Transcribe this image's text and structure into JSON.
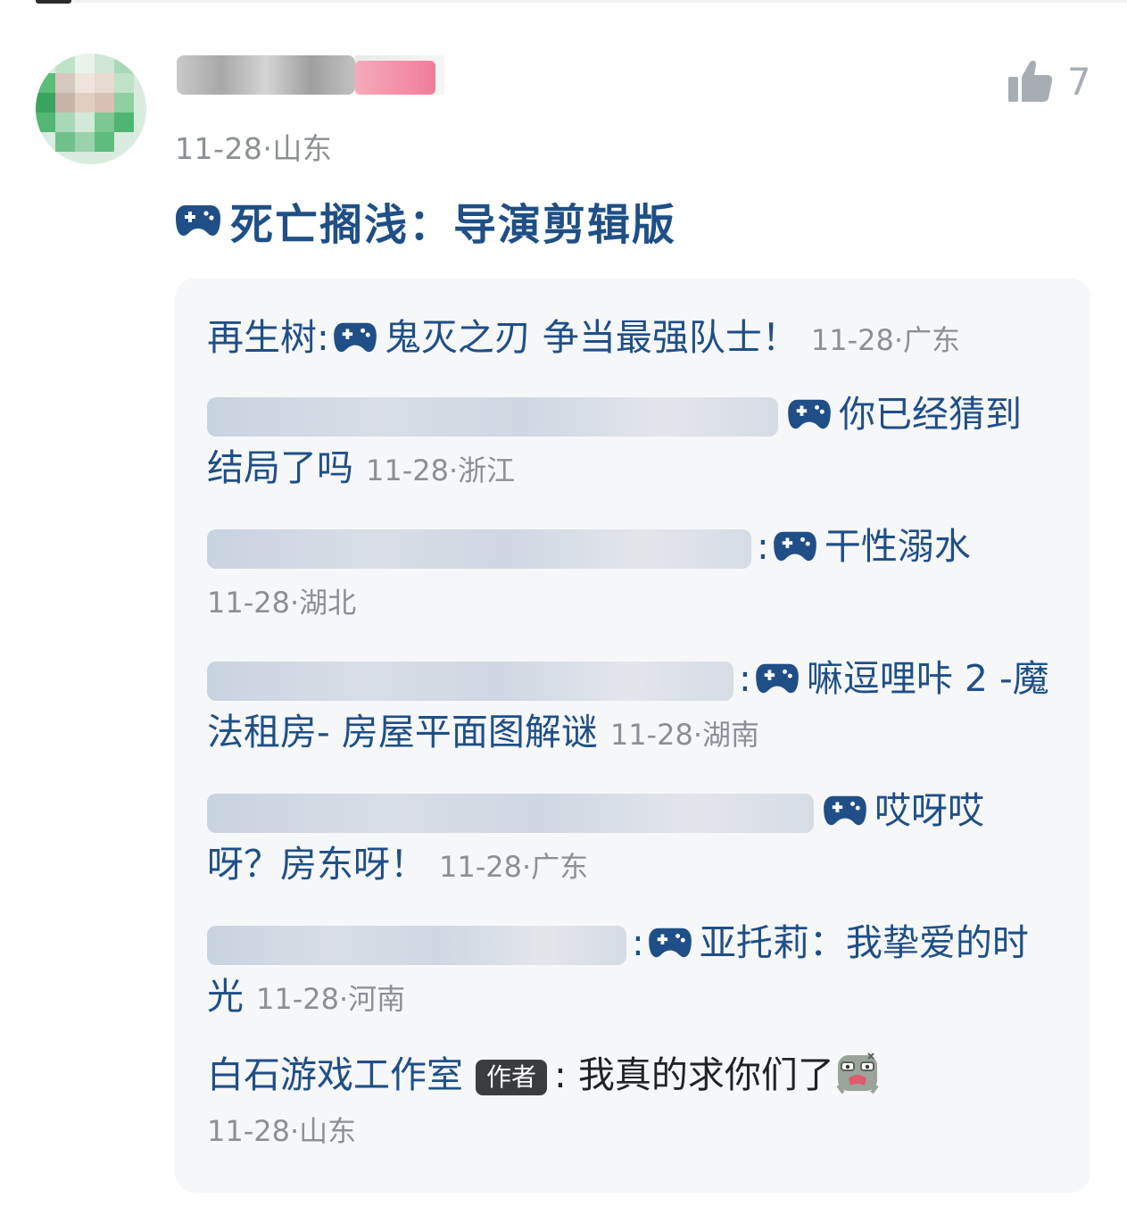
{
  "comment": {
    "date": "11-28",
    "location": "山东",
    "game_title": "死亡搁浅：导演剪辑版",
    "like_count": "7"
  },
  "replies": [
    {
      "user": "再生树:",
      "game_title": "鬼灭之刃 争当最强队士！",
      "date": "11-28",
      "location": "广东"
    },
    {
      "user_hidden": true,
      "game_title": "你已经猜到结局了吗",
      "date": "11-28",
      "location": "浙江"
    },
    {
      "user_hidden": true,
      "game_title": "干性溺水",
      "date": "11-28",
      "location": "湖北"
    },
    {
      "user_hidden": true,
      "game_title": "嘛逗哩咔 2 -魔法租房- 房屋平面图解谜",
      "date": "11-28",
      "location": "湖南"
    },
    {
      "user_hidden": true,
      "game_title": "哎呀哎呀？房东呀！",
      "date": "11-28",
      "location": "广东"
    },
    {
      "user_hidden": true,
      "game_title": "亚托莉：我挚爱的时光",
      "date": "11-28",
      "location": "河南"
    },
    {
      "user": "白石游戏工作室",
      "badge": "作者",
      "text": "我真的求你们了",
      "emoji_icon": "crying-face-sticker",
      "date": "11-28",
      "location": "山东"
    }
  ],
  "colors": {
    "link": "#1f4f86",
    "meta": "#8b9096",
    "reply_bg": "#f6f7f9",
    "badge_bg": "#3a3c40"
  },
  "icons": {
    "game": "gamepad-icon",
    "like": "thumbs-up-icon"
  }
}
